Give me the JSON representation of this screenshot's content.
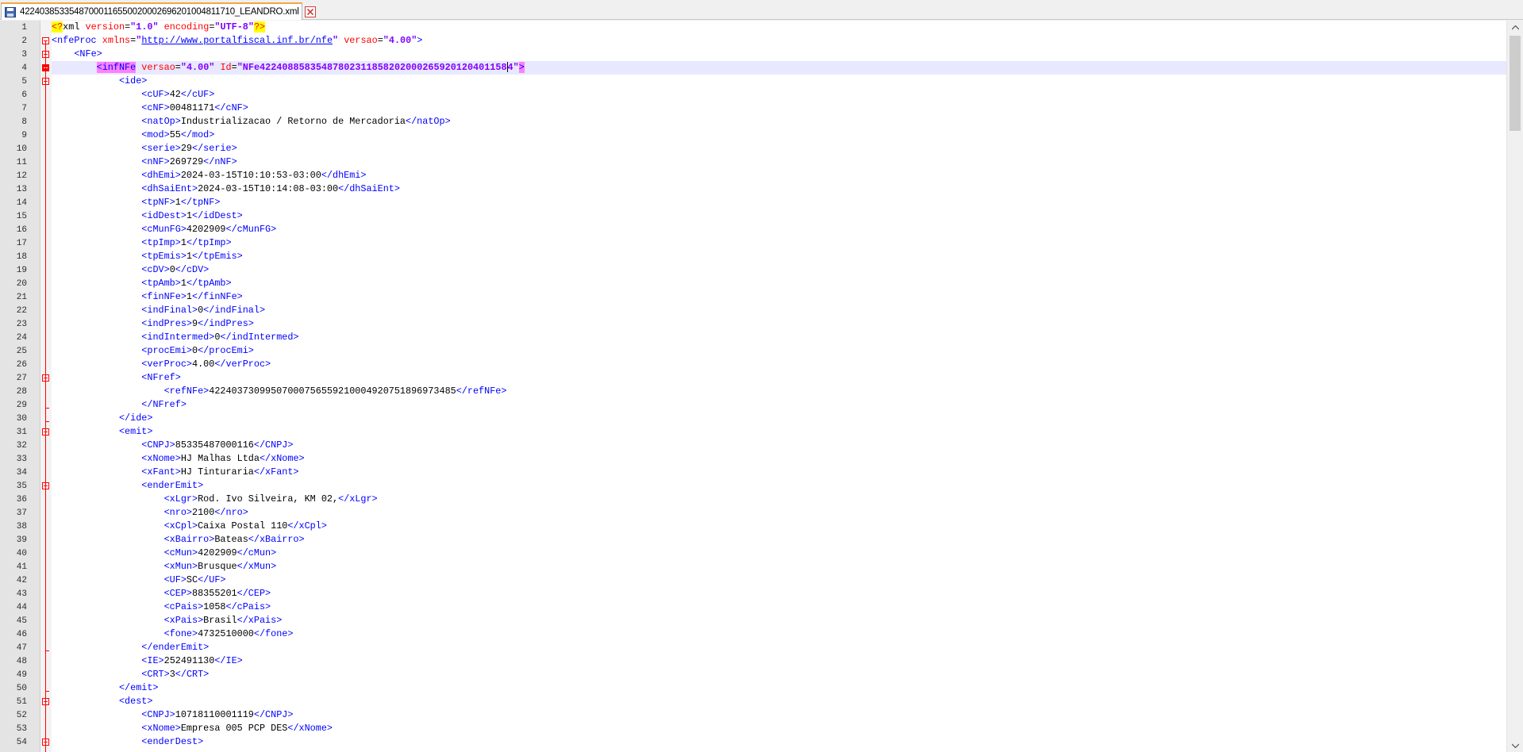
{
  "tab": {
    "title": "42240385335487000116550020002696201004811710_LEANDRO.xml",
    "icon": "save-disk-icon",
    "close_icon": "close-icon",
    "accent_color": "#f4a742"
  },
  "editor": {
    "current_line": 4,
    "lines": [
      {
        "n": "1",
        "fold": "none",
        "html": "<span class=\"t-decl\">&lt;?</span><span class=\"t-txt\">xml</span> <span class=\"t-attr\">version</span><span class=\"t-txt\">=</span><span class=\"t-val\">\"1.0\"</span> <span class=\"t-attr\">encoding</span><span class=\"t-txt\">=</span><span class=\"t-val\">\"UTF-8\"</span><span class=\"t-decl\">?&gt;</span>"
      },
      {
        "n": "2",
        "fold": "open",
        "html": "<span class=\"t-tag\">&lt;nfeProc</span> <span class=\"t-attr\">xmlns</span><span class=\"t-txt\">=</span><span class=\"t-val\">\"</span><span class=\"t-url\">http://www.portalfiscal.inf.br/nfe</span><span class=\"t-val\">\"</span> <span class=\"t-attr\">versao</span><span class=\"t-txt\">=</span><span class=\"t-val\">\"4.00\"</span><span class=\"t-tag\">&gt;</span>"
      },
      {
        "n": "3",
        "fold": "open",
        "html": "    <span class=\"t-tag\">&lt;NFe&gt;</span>"
      },
      {
        "n": "4",
        "fold": "open",
        "html": "        <span class=\"t-tag t-hl2\">&lt;infNFe</span> <span class=\"t-attr\">versao</span><span class=\"t-txt\">=</span><span class=\"t-val\">\"4.00\"</span> <span class=\"t-attr\">Id</span><span class=\"t-txt\">=</span><span class=\"t-val\">\"NFe42240885835487802311858202000265920120401158 4\"</span><span class=\"t-tag t-hl2\">&gt;</span>"
      },
      {
        "n": "5",
        "fold": "open",
        "html": "            <span class=\"t-tag\">&lt;ide&gt;</span>"
      },
      {
        "n": "6",
        "fold": "none",
        "html": "                <span class=\"t-tag\">&lt;cUF&gt;</span>42<span class=\"t-tag\">&lt;/cUF&gt;</span>"
      },
      {
        "n": "7",
        "fold": "none",
        "html": "                <span class=\"t-tag\">&lt;cNF&gt;</span>00481171<span class=\"t-tag\">&lt;/cNF&gt;</span>"
      },
      {
        "n": "8",
        "fold": "none",
        "html": "                <span class=\"t-tag\">&lt;natOp&gt;</span>Industrializacao / Retorno de Mercadoria<span class=\"t-tag\">&lt;/natOp&gt;</span>"
      },
      {
        "n": "9",
        "fold": "none",
        "html": "                <span class=\"t-tag\">&lt;mod&gt;</span>55<span class=\"t-tag\">&lt;/mod&gt;</span>"
      },
      {
        "n": "10",
        "fold": "none",
        "html": "                <span class=\"t-tag\">&lt;serie&gt;</span>29<span class=\"t-tag\">&lt;/serie&gt;</span>"
      },
      {
        "n": "11",
        "fold": "none",
        "html": "                <span class=\"t-tag\">&lt;nNF&gt;</span>269729<span class=\"t-tag\">&lt;/nNF&gt;</span>"
      },
      {
        "n": "12",
        "fold": "none",
        "html": "                <span class=\"t-tag\">&lt;dhEmi&gt;</span>2024-03-15T10:10:53-03:00<span class=\"t-tag\">&lt;/dhEmi&gt;</span>"
      },
      {
        "n": "13",
        "fold": "none",
        "html": "                <span class=\"t-tag\">&lt;dhSaiEnt&gt;</span>2024-03-15T10:14:08-03:00<span class=\"t-tag\">&lt;/dhSaiEnt&gt;</span>"
      },
      {
        "n": "14",
        "fold": "none",
        "html": "                <span class=\"t-tag\">&lt;tpNF&gt;</span>1<span class=\"t-tag\">&lt;/tpNF&gt;</span>"
      },
      {
        "n": "15",
        "fold": "none",
        "html": "                <span class=\"t-tag\">&lt;idDest&gt;</span>1<span class=\"t-tag\">&lt;/idDest&gt;</span>"
      },
      {
        "n": "16",
        "fold": "none",
        "html": "                <span class=\"t-tag\">&lt;cMunFG&gt;</span>4202909<span class=\"t-tag\">&lt;/cMunFG&gt;</span>"
      },
      {
        "n": "17",
        "fold": "none",
        "html": "                <span class=\"t-tag\">&lt;tpImp&gt;</span>1<span class=\"t-tag\">&lt;/tpImp&gt;</span>"
      },
      {
        "n": "18",
        "fold": "none",
        "html": "                <span class=\"t-tag\">&lt;tpEmis&gt;</span>1<span class=\"t-tag\">&lt;/tpEmis&gt;</span>"
      },
      {
        "n": "19",
        "fold": "none",
        "html": "                <span class=\"t-tag\">&lt;cDV&gt;</span>0<span class=\"t-tag\">&lt;/cDV&gt;</span>"
      },
      {
        "n": "20",
        "fold": "none",
        "html": "                <span class=\"t-tag\">&lt;tpAmb&gt;</span>1<span class=\"t-tag\">&lt;/tpAmb&gt;</span>"
      },
      {
        "n": "21",
        "fold": "none",
        "html": "                <span class=\"t-tag\">&lt;finNFe&gt;</span>1<span class=\"t-tag\">&lt;/finNFe&gt;</span>"
      },
      {
        "n": "22",
        "fold": "none",
        "html": "                <span class=\"t-tag\">&lt;indFinal&gt;</span>0<span class=\"t-tag\">&lt;/indFinal&gt;</span>"
      },
      {
        "n": "23",
        "fold": "none",
        "html": "                <span class=\"t-tag\">&lt;indPres&gt;</span>9<span class=\"t-tag\">&lt;/indPres&gt;</span>"
      },
      {
        "n": "24",
        "fold": "none",
        "html": "                <span class=\"t-tag\">&lt;indIntermed&gt;</span>0<span class=\"t-tag\">&lt;/indIntermed&gt;</span>"
      },
      {
        "n": "25",
        "fold": "none",
        "html": "                <span class=\"t-tag\">&lt;procEmi&gt;</span>0<span class=\"t-tag\">&lt;/procEmi&gt;</span>"
      },
      {
        "n": "26",
        "fold": "none",
        "html": "                <span class=\"t-tag\">&lt;verProc&gt;</span>4.00<span class=\"t-tag\">&lt;/verProc&gt;</span>"
      },
      {
        "n": "27",
        "fold": "open",
        "html": "                <span class=\"t-tag\">&lt;NFref&gt;</span>"
      },
      {
        "n": "28",
        "fold": "none",
        "html": "                    <span class=\"t-tag\">&lt;refNFe&gt;</span>42240373099507000756559210004920751896973485<span class=\"t-tag\">&lt;/refNFe&gt;</span>"
      },
      {
        "n": "29",
        "fold": "end",
        "html": "                <span class=\"t-tag\">&lt;/NFref&gt;</span>"
      },
      {
        "n": "30",
        "fold": "end",
        "html": "            <span class=\"t-tag\">&lt;/ide&gt;</span>"
      },
      {
        "n": "31",
        "fold": "open",
        "html": "            <span class=\"t-tag\">&lt;emit&gt;</span>"
      },
      {
        "n": "32",
        "fold": "none",
        "html": "                <span class=\"t-tag\">&lt;CNPJ&gt;</span>85335487000116<span class=\"t-tag\">&lt;/CNPJ&gt;</span>"
      },
      {
        "n": "33",
        "fold": "none",
        "html": "                <span class=\"t-tag\">&lt;xNome&gt;</span>HJ Malhas Ltda<span class=\"t-tag\">&lt;/xNome&gt;</span>"
      },
      {
        "n": "34",
        "fold": "none",
        "html": "                <span class=\"t-tag\">&lt;xFant&gt;</span>HJ Tinturaria<span class=\"t-tag\">&lt;/xFant&gt;</span>"
      },
      {
        "n": "35",
        "fold": "open",
        "html": "                <span class=\"t-tag\">&lt;enderEmit&gt;</span>"
      },
      {
        "n": "36",
        "fold": "none",
        "html": "                    <span class=\"t-tag\">&lt;xLgr&gt;</span>Rod. Ivo Silveira, KM 02,<span class=\"t-tag\">&lt;/xLgr&gt;</span>"
      },
      {
        "n": "37",
        "fold": "none",
        "html": "                    <span class=\"t-tag\">&lt;nro&gt;</span>2100<span class=\"t-tag\">&lt;/nro&gt;</span>"
      },
      {
        "n": "38",
        "fold": "none",
        "html": "                    <span class=\"t-tag\">&lt;xCpl&gt;</span>Caixa Postal 110<span class=\"t-tag\">&lt;/xCpl&gt;</span>"
      },
      {
        "n": "39",
        "fold": "none",
        "html": "                    <span class=\"t-tag\">&lt;xBairro&gt;</span>Bateas<span class=\"t-tag\">&lt;/xBairro&gt;</span>"
      },
      {
        "n": "40",
        "fold": "none",
        "html": "                    <span class=\"t-tag\">&lt;cMun&gt;</span>4202909<span class=\"t-tag\">&lt;/cMun&gt;</span>"
      },
      {
        "n": "41",
        "fold": "none",
        "html": "                    <span class=\"t-tag\">&lt;xMun&gt;</span>Brusque<span class=\"t-tag\">&lt;/xMun&gt;</span>"
      },
      {
        "n": "42",
        "fold": "none",
        "html": "                    <span class=\"t-tag\">&lt;UF&gt;</span>SC<span class=\"t-tag\">&lt;/UF&gt;</span>"
      },
      {
        "n": "43",
        "fold": "none",
        "html": "                    <span class=\"t-tag\">&lt;CEP&gt;</span>88355201<span class=\"t-tag\">&lt;/CEP&gt;</span>"
      },
      {
        "n": "44",
        "fold": "none",
        "html": "                    <span class=\"t-tag\">&lt;cPais&gt;</span>1058<span class=\"t-tag\">&lt;/cPais&gt;</span>"
      },
      {
        "n": "45",
        "fold": "none",
        "html": "                    <span class=\"t-tag\">&lt;xPais&gt;</span>Brasil<span class=\"t-tag\">&lt;/xPais&gt;</span>"
      },
      {
        "n": "46",
        "fold": "none",
        "html": "                    <span class=\"t-tag\">&lt;fone&gt;</span>4732510000<span class=\"t-tag\">&lt;/fone&gt;</span>"
      },
      {
        "n": "47",
        "fold": "end",
        "html": "                <span class=\"t-tag\">&lt;/enderEmit&gt;</span>"
      },
      {
        "n": "48",
        "fold": "none",
        "html": "                <span class=\"t-tag\">&lt;IE&gt;</span>252491130<span class=\"t-tag\">&lt;/IE&gt;</span>"
      },
      {
        "n": "49",
        "fold": "none",
        "html": "                <span class=\"t-tag\">&lt;CRT&gt;</span>3<span class=\"t-tag\">&lt;/CRT&gt;</span>"
      },
      {
        "n": "50",
        "fold": "end",
        "html": "            <span class=\"t-tag\">&lt;/emit&gt;</span>"
      },
      {
        "n": "51",
        "fold": "open",
        "html": "            <span class=\"t-tag\">&lt;dest&gt;</span>"
      },
      {
        "n": "52",
        "fold": "none",
        "html": "                <span class=\"t-tag\">&lt;CNPJ&gt;</span>10718110001119<span class=\"t-tag\">&lt;/CNPJ&gt;</span>"
      },
      {
        "n": "53",
        "fold": "none",
        "html": "                <span class=\"t-tag\">&lt;xNome&gt;</span>Empresa 005 PCP DES<span class=\"t-tag\">&lt;/xNome&gt;</span>"
      },
      {
        "n": "54",
        "fold": "open",
        "html": "                <span class=\"t-tag\">&lt;enderDest&gt;</span>"
      }
    ]
  },
  "scrollbar": {
    "up_icon": "arrow-up-icon",
    "down_icon": "arrow-down-icon"
  }
}
